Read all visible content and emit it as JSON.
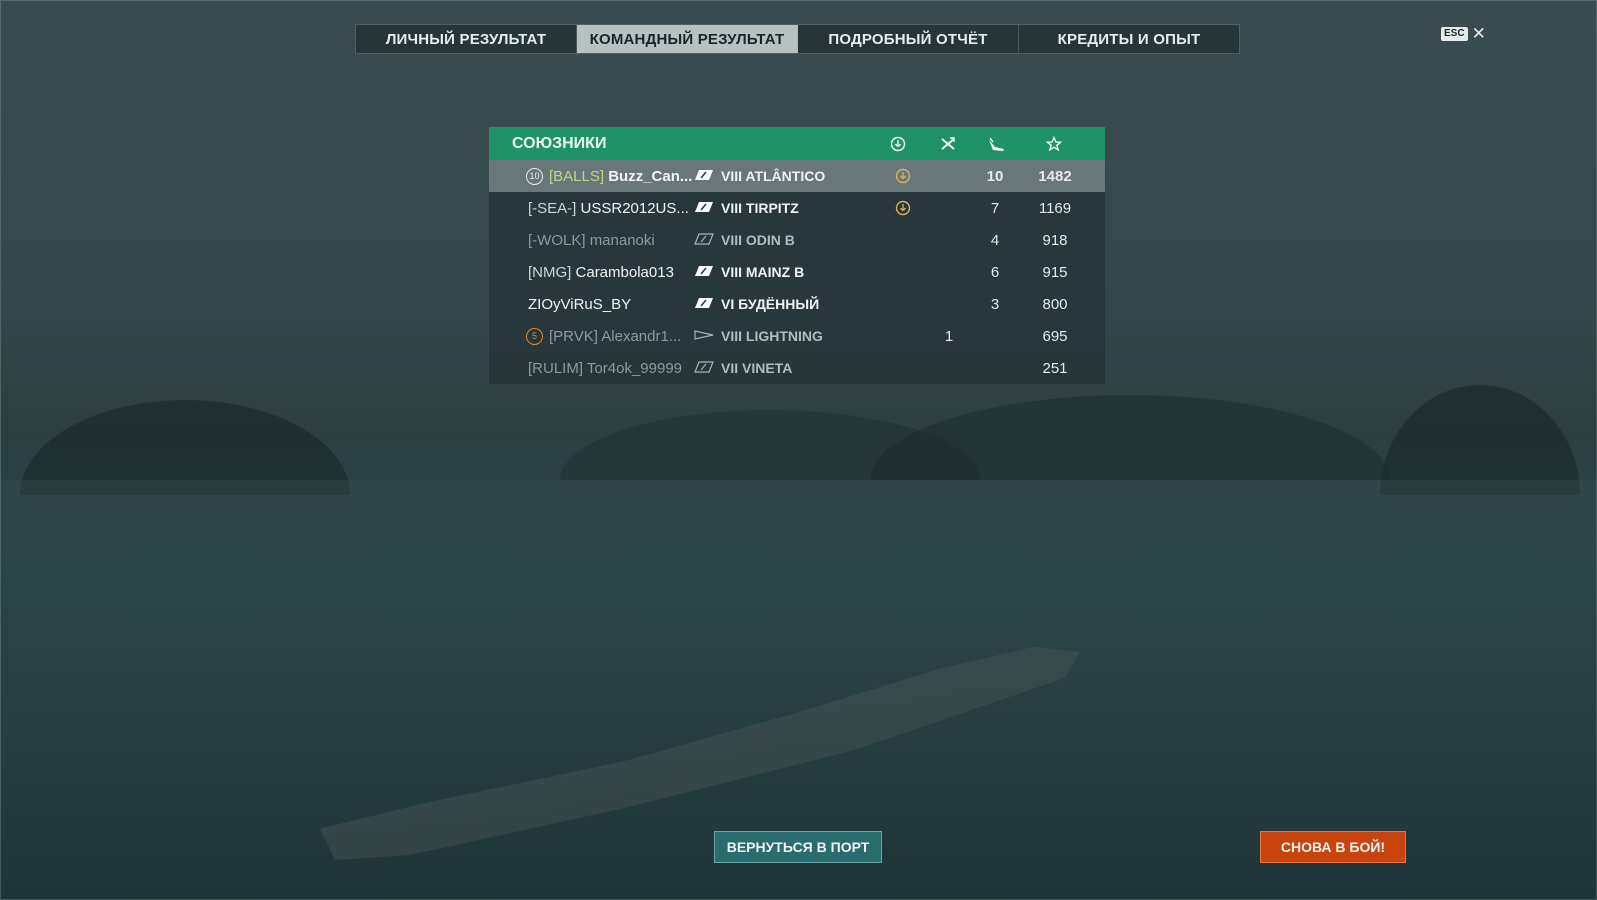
{
  "tabs": [
    {
      "label": "ЛИЧНЫЙ РЕЗУЛЬТАТ",
      "active": false
    },
    {
      "label": "КОМАНДНЫЙ РЕЗУЛЬТАТ",
      "active": true
    },
    {
      "label": "ПОДРОБНЫЙ ОТЧЁТ",
      "active": false
    },
    {
      "label": "КРЕДИТЫ И ОПЫТ",
      "active": false
    }
  ],
  "close": {
    "key_label": "ESC",
    "icon": "close-icon"
  },
  "team_table": {
    "title": "СОЮЗНИКИ",
    "header_icons": [
      "base-capture-icon",
      "planes-shot-icon",
      "ships-destroyed-icon",
      "base-xp-star-icon"
    ],
    "rows": [
      {
        "rank": "10",
        "clan": "[BALLS]",
        "name": "Buzz_Can...",
        "ship": "VIII ATLÂNTICO",
        "medal": true,
        "planes": "",
        "kills": "10",
        "xp": "1482",
        "me": true,
        "dim": false
      },
      {
        "rank": "",
        "clan": "[-SEA-]",
        "name": "USSR2012US...",
        "ship": "VIII TIRPITZ",
        "medal": true,
        "planes": "",
        "kills": "7",
        "xp": "1169",
        "me": false,
        "dim": false
      },
      {
        "rank": "",
        "clan": "[-WOLK]",
        "name": "mananoki",
        "ship": "VIII ODIN B",
        "medal": false,
        "planes": "",
        "kills": "4",
        "xp": "918",
        "me": false,
        "dim": true
      },
      {
        "rank": "",
        "clan": "[NMG]",
        "name": "Carambola013",
        "ship": "VIII MAINZ B",
        "medal": false,
        "planes": "",
        "kills": "6",
        "xp": "915",
        "me": false,
        "dim": false
      },
      {
        "rank": "",
        "clan": "",
        "name": "ZIOyViRuS_BY",
        "ship": "VI БУДЁННЫЙ",
        "medal": false,
        "planes": "",
        "kills": "3",
        "xp": "800",
        "me": false,
        "dim": false
      },
      {
        "rank": "5",
        "clan": "[PRVK]",
        "name": "Alexandr1...",
        "ship": "VIII LIGHTNING",
        "medal": false,
        "planes": "1",
        "kills": "",
        "xp": "695",
        "me": false,
        "dim": true
      },
      {
        "rank": "",
        "clan": "[RULIM]",
        "name": "Tor4ok_99999",
        "ship": "VII VINETA",
        "medal": false,
        "planes": "",
        "kills": "",
        "xp": "251",
        "me": false,
        "dim": true
      }
    ]
  },
  "buttons": {
    "port": "ВЕРНУТЬСЯ В ПОРТ",
    "battle": "СНОВА В БОЙ!"
  },
  "colors": {
    "header_green": "#1f9268",
    "battle_orange": "#c9430f",
    "port_teal": "#2a6b6d",
    "clan_highlight": "#b7d88a"
  }
}
